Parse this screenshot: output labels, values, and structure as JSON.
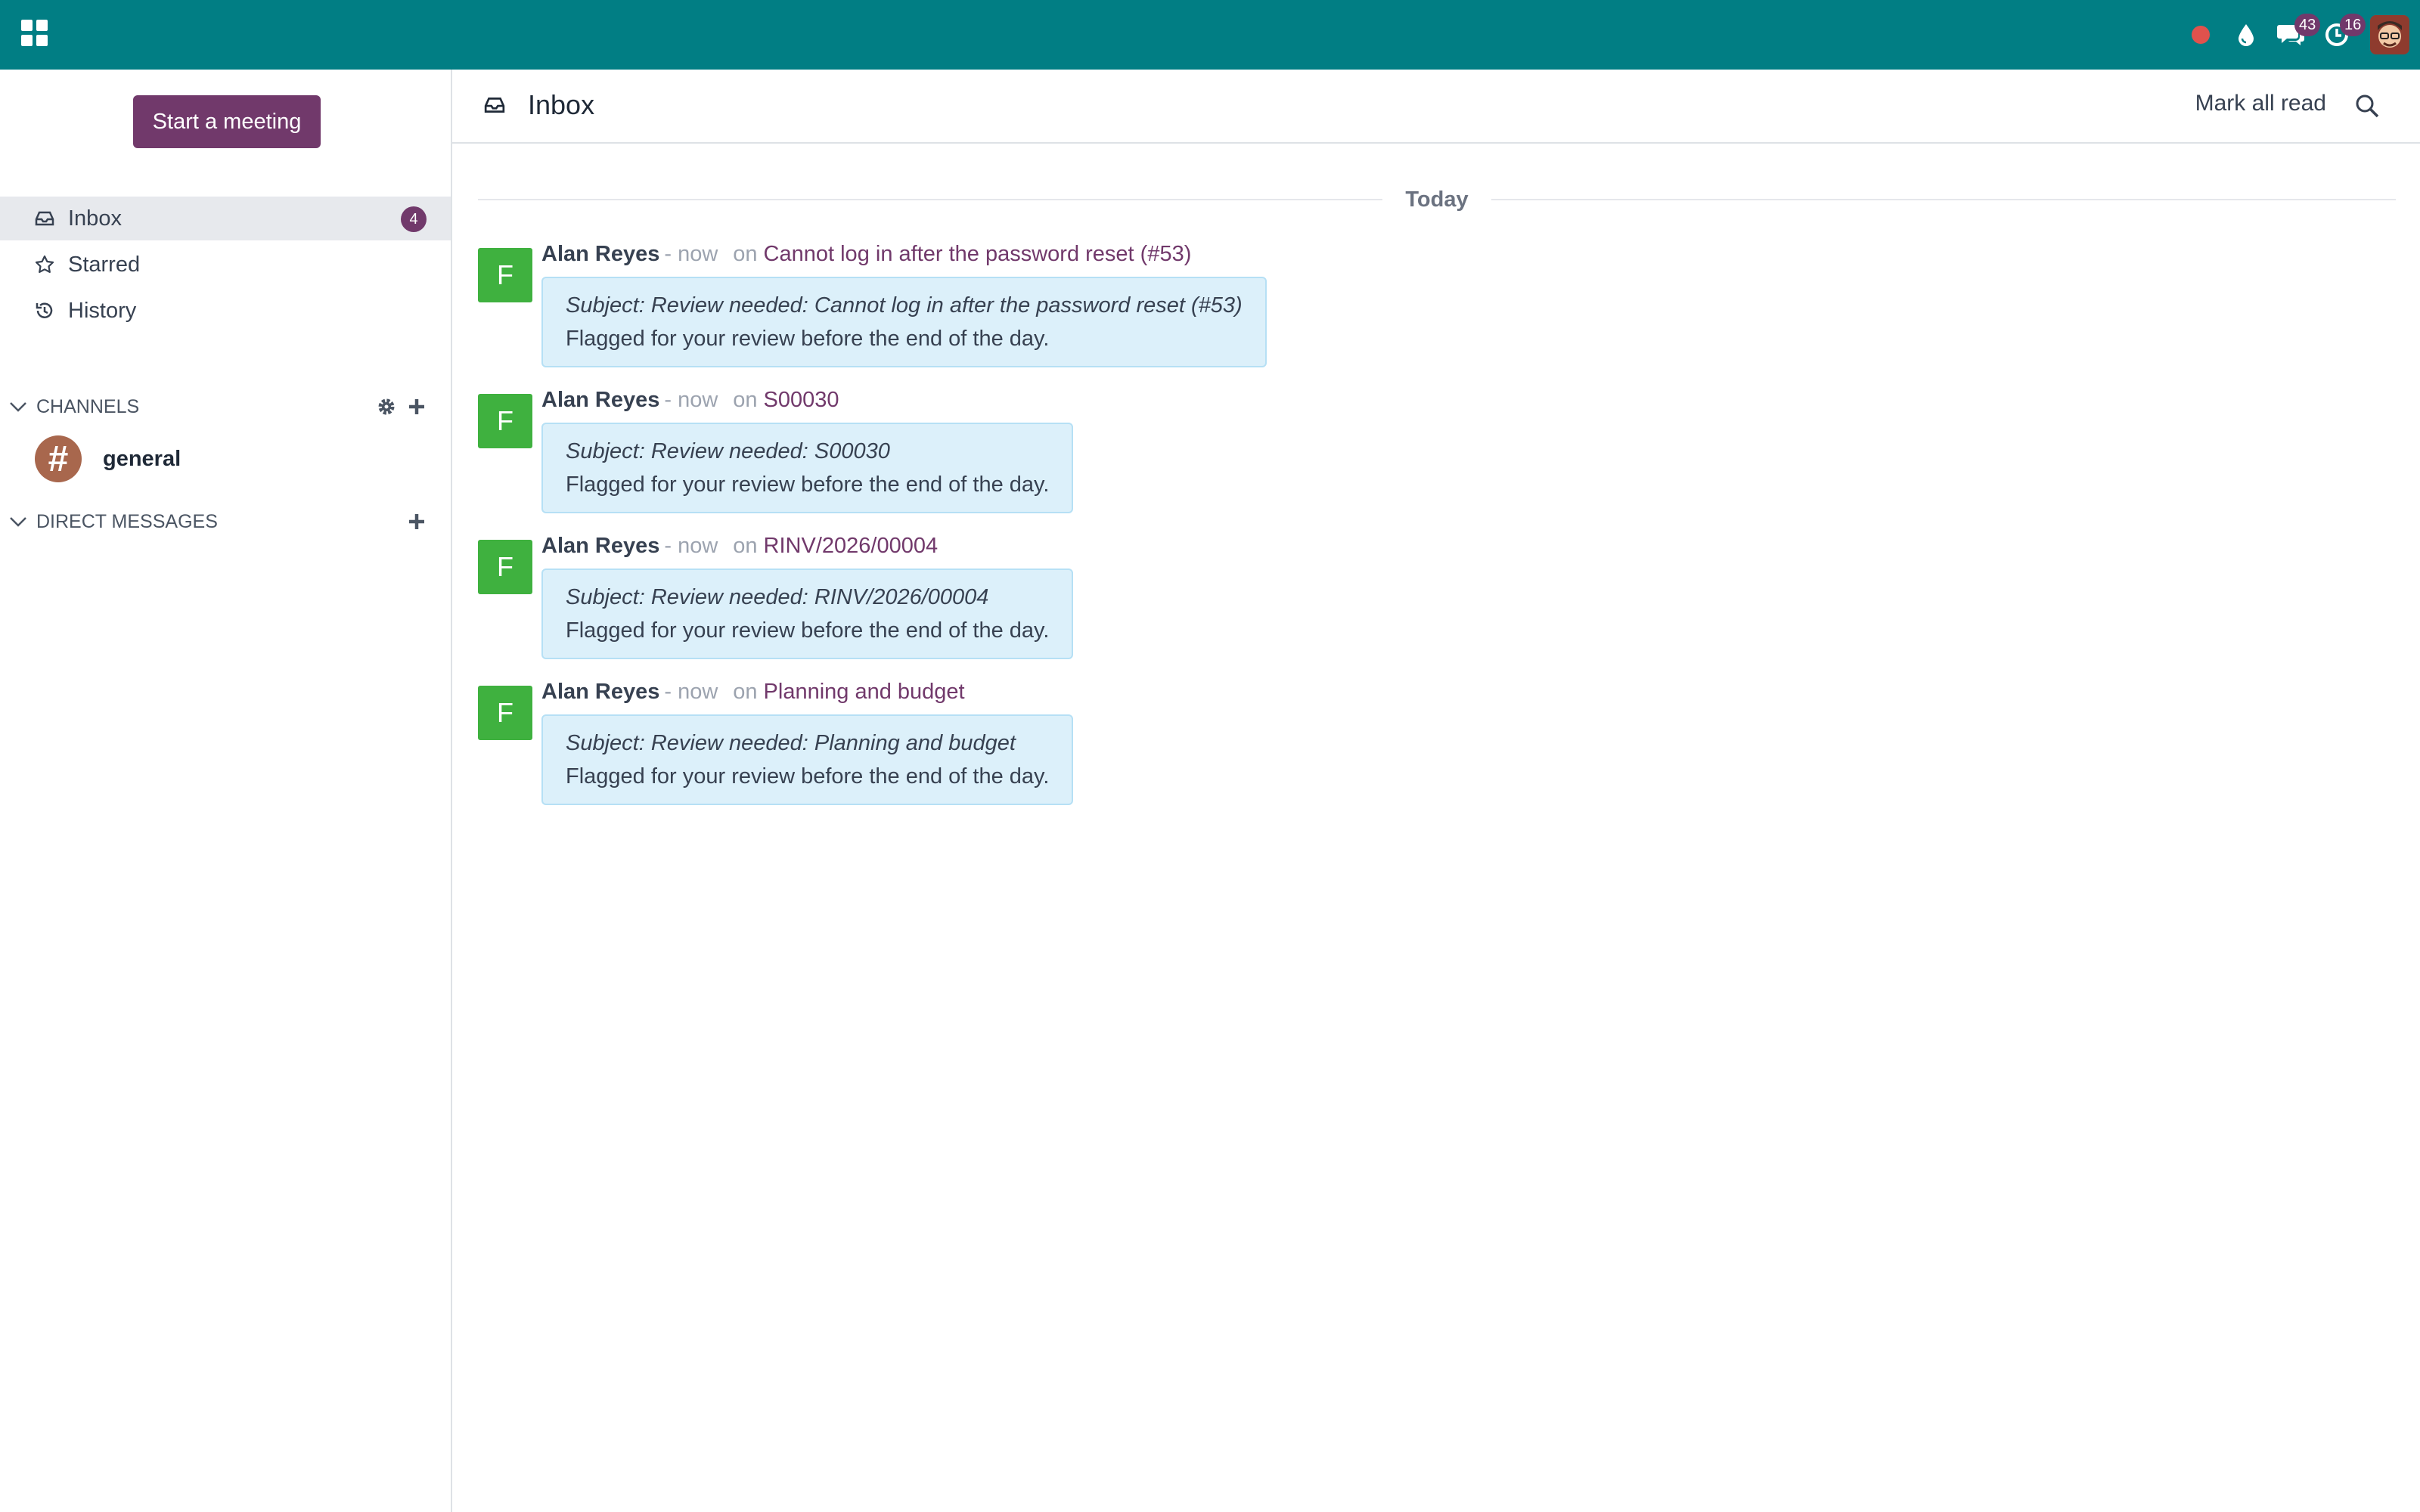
{
  "topbar": {
    "apps_icon": "grid-apps-icon",
    "messages_badge": "43",
    "activities_badge": "16",
    "colors": {
      "bar": "#017e84",
      "badge": "#71396b",
      "recording": "#e0524d"
    }
  },
  "sidebar": {
    "start_meeting_label": "Start a meeting",
    "nav": [
      {
        "label": "Inbox",
        "icon": "inbox-icon",
        "badge": "4",
        "active": true
      },
      {
        "label": "Starred",
        "icon": "star-icon"
      },
      {
        "label": "History",
        "icon": "history-icon"
      }
    ],
    "channels": {
      "header": "CHANNELS",
      "items": [
        {
          "symbol": "#",
          "name": "general"
        }
      ]
    },
    "direct_messages": {
      "header": "DIRECT MESSAGES"
    }
  },
  "main": {
    "title": "Inbox",
    "mark_all_read": "Mark all read",
    "day_separator": "Today",
    "messages": [
      {
        "avatar_letter": "F",
        "author": "Alan Reyes",
        "time": "- now",
        "on": "on",
        "record": "Cannot log in after the password reset (#53)",
        "subject": "Subject: Review needed: Cannot log in after the password reset (#53)",
        "body": "Flagged for your review before the end of the day."
      },
      {
        "avatar_letter": "F",
        "author": "Alan Reyes",
        "time": "- now",
        "on": "on",
        "record": "S00030",
        "subject": "Subject: Review needed: S00030",
        "body": "Flagged for your review before the end of the day."
      },
      {
        "avatar_letter": "F",
        "author": "Alan Reyes",
        "time": "- now",
        "on": "on",
        "record": "RINV/2026/00004",
        "subject": "Subject: Review needed: RINV/2026/00004",
        "body": "Flagged for your review before the end of the day."
      },
      {
        "avatar_letter": "F",
        "author": "Alan Reyes",
        "time": "- now",
        "on": "on",
        "record": "Planning and budget",
        "subject": "Subject: Review needed: Planning and budget",
        "body": "Flagged for your review before the end of the day."
      }
    ]
  }
}
